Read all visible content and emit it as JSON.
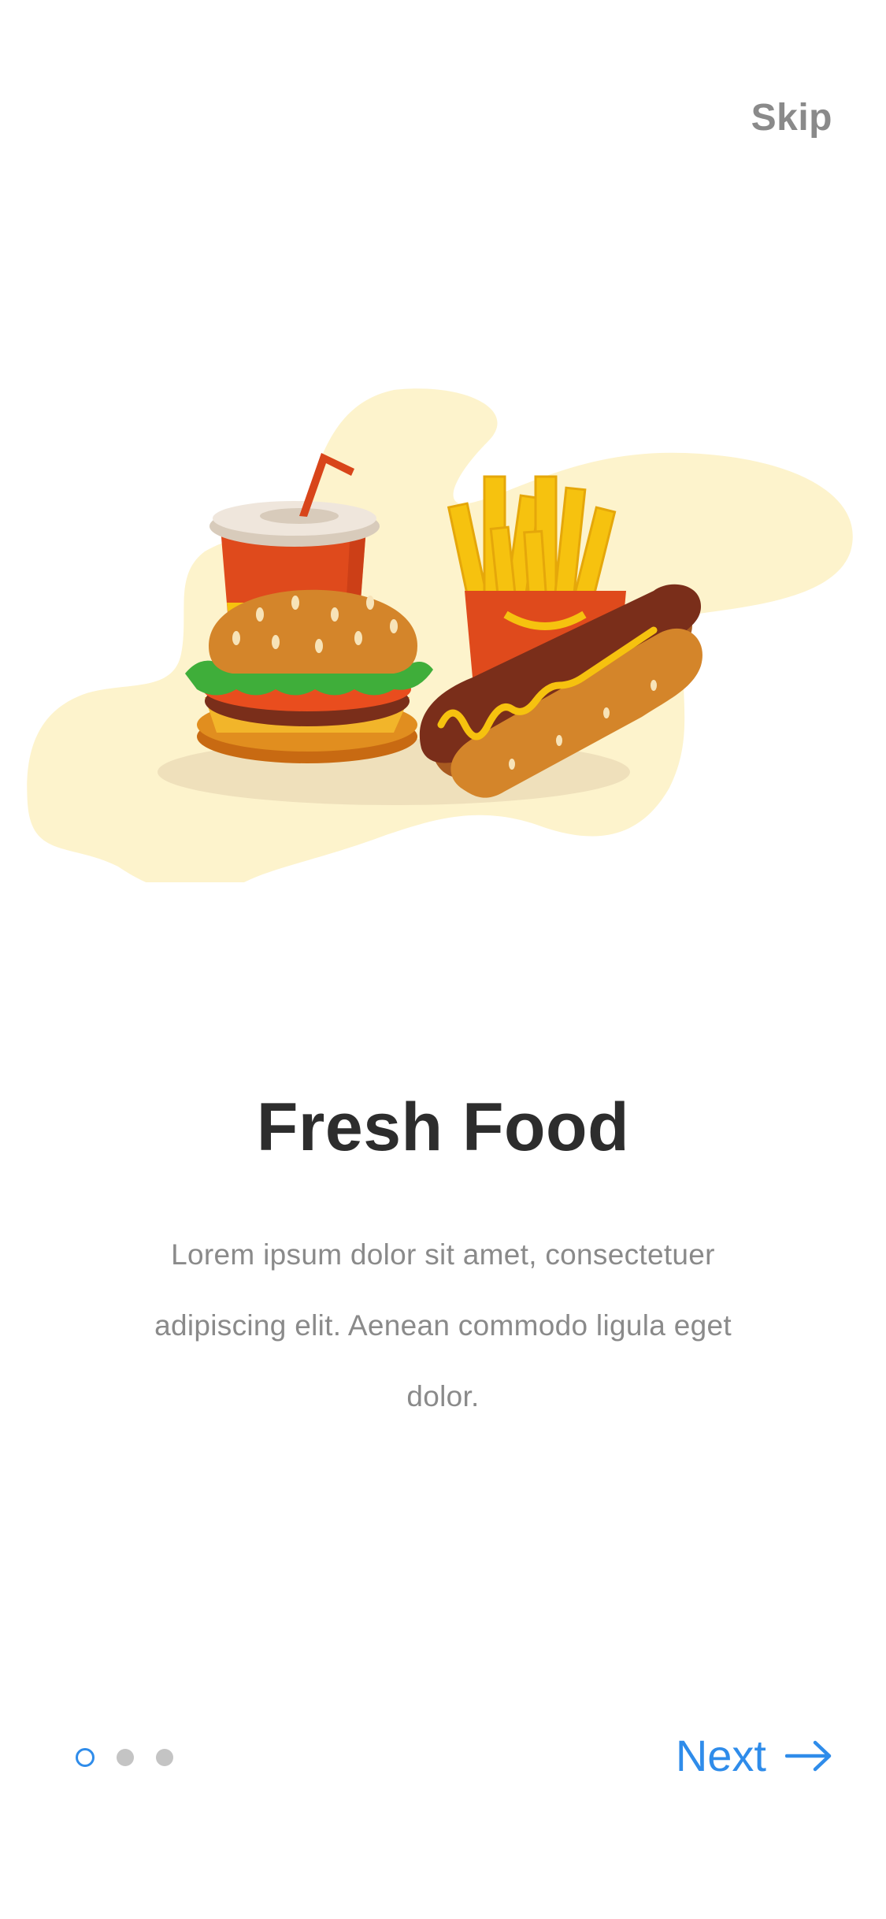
{
  "header": {
    "skip_label": "Skip"
  },
  "onboarding": {
    "title": "Fresh Food",
    "description": "Lorem ipsum dolor sit amet, consectetuer adipiscing elit. Aenean commodo ligula eget dolor.",
    "illustration_icon": "fast-food-illustration"
  },
  "pagination": {
    "total_pages": 3,
    "current_page": 1
  },
  "footer": {
    "next_label": "Next",
    "next_icon": "arrow-right-icon"
  },
  "colors": {
    "accent": "#2f8cea",
    "title": "#2d2d2d",
    "muted_text": "#8a8a8a",
    "inactive_dot": "#c4c4c4",
    "blob": "#fdf3cc"
  }
}
